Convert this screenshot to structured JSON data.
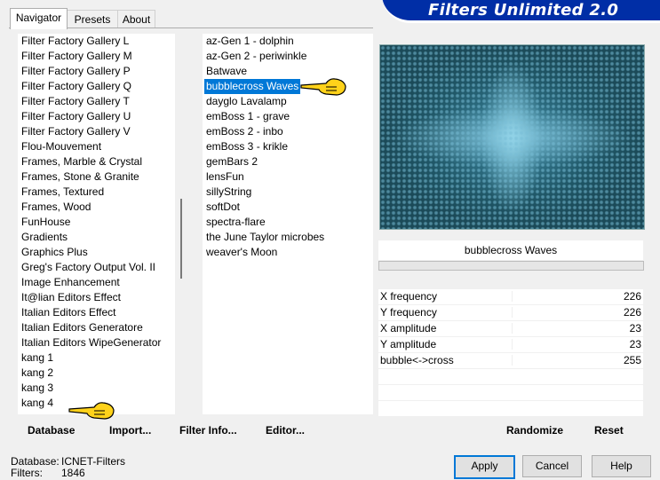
{
  "window": {
    "title": "Filters Unlimited 2.0"
  },
  "tabs": [
    {
      "label": "Navigator",
      "active": true
    },
    {
      "label": "Presets",
      "active": false
    },
    {
      "label": "About",
      "active": false
    }
  ],
  "categories": {
    "items": [
      "Filter Factory Gallery L",
      "Filter Factory Gallery M",
      "Filter Factory Gallery P",
      "Filter Factory Gallery Q",
      "Filter Factory Gallery T",
      "Filter Factory Gallery U",
      "Filter Factory Gallery V",
      "Flou-Mouvement",
      "Frames, Marble & Crystal",
      "Frames, Stone & Granite",
      "Frames, Textured",
      "Frames, Wood",
      "FunHouse",
      "Gradients",
      "Graphics Plus",
      "Greg's Factory Output Vol. II",
      "Image Enhancement",
      "It@lian Editors Effect",
      "Italian Editors Effect",
      "Italian Editors Generatore",
      "Italian Editors WipeGenerator",
      "kang 1",
      "kang 2",
      "kang 3",
      "kang 4"
    ]
  },
  "filters": {
    "items": [
      "az-Gen 1  -  dolphin",
      "az-Gen 2  -  periwinkle",
      "Batwave",
      "bubblecross Waves",
      "dayglo Lavalamp",
      "emBoss 1  -  grave",
      "emBoss 2  -  inbo",
      "emBoss 3  -  krikle",
      "gemBars 2",
      "lensFun",
      "sillyString",
      "softDot",
      "spectra-flare",
      "the June Taylor microbes",
      "weaver's Moon"
    ],
    "selected_index": 3
  },
  "preview": {
    "filter_name": "bubblecross Waves",
    "colors": {
      "dark": "#1f5666",
      "light": "#7cc4dc"
    }
  },
  "params": [
    {
      "label": "X frequency",
      "value": "226"
    },
    {
      "label": "Y frequency",
      "value": "226"
    },
    {
      "label": "X amplitude",
      "value": "23"
    },
    {
      "label": "Y amplitude",
      "value": "23"
    },
    {
      "label": "bubble<->cross",
      "value": "255"
    }
  ],
  "toolbar": {
    "database": "Database",
    "import": "Import...",
    "filter_info": "Filter Info...",
    "editor": "Editor...",
    "randomize": "Randomize",
    "reset": "Reset"
  },
  "status": {
    "database_label": "Database:",
    "database_value": "ICNET-Filters",
    "filters_label": "Filters:",
    "filters_value": "1846"
  },
  "buttons": {
    "apply": "Apply",
    "cancel": "Cancel",
    "help": "Help"
  },
  "accent_color": "#0078d7",
  "banner_color": "#002ea6",
  "icons": [
    "pointing-hand-icon"
  ]
}
